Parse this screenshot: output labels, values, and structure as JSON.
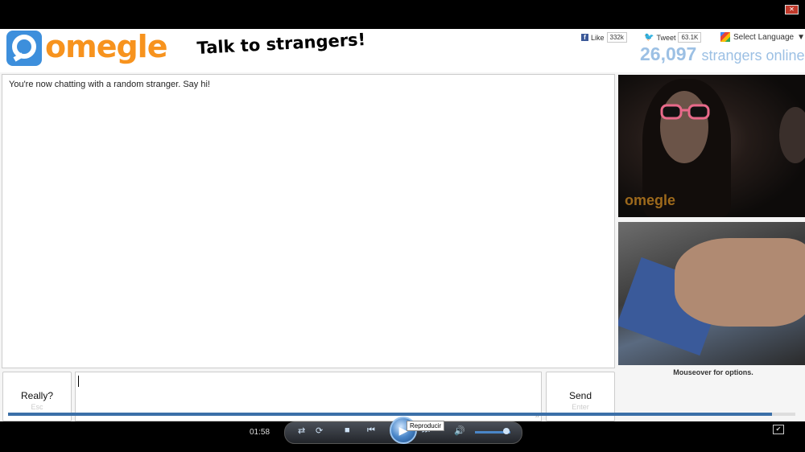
{
  "header": {
    "logo_text": "omegle",
    "tagline": "Talk to strangers!",
    "facebook": {
      "label": "Like",
      "count": "332k"
    },
    "twitter": {
      "label": "Tweet",
      "count": "63.1K"
    },
    "language": "Select Language",
    "online_count": "26,097",
    "online_label": "strangers online"
  },
  "chat": {
    "status_message": "You're now chatting with a random stranger. Say hi!"
  },
  "video": {
    "watermark": "omegle",
    "hint": "Mouseover for options."
  },
  "controls": {
    "disconnect": {
      "label": "Really?",
      "shortcut": "Esc"
    },
    "send": {
      "label": "Send",
      "shortcut": "Enter"
    }
  },
  "player": {
    "time": "01:58",
    "tooltip": "Reproducir",
    "progress": 0.97
  },
  "colors": {
    "brand_orange": "#f7931e",
    "brand_blue": "#3d8fdc",
    "online_blue": "#9cc0e4"
  }
}
